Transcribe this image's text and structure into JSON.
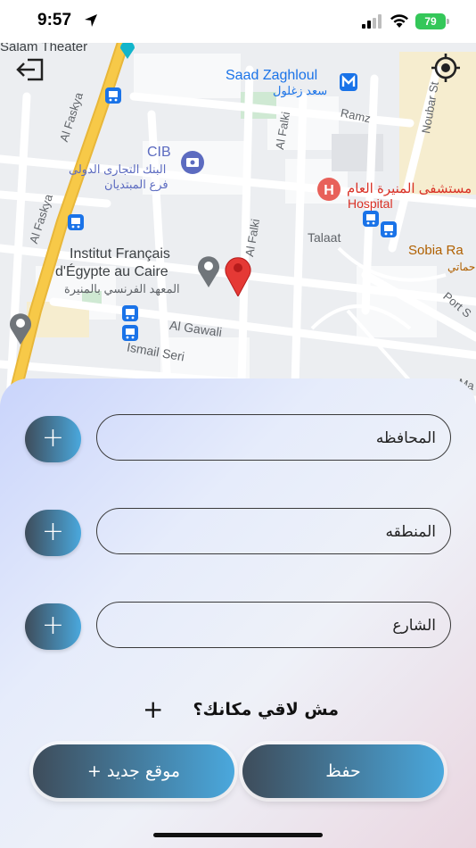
{
  "status_bar": {
    "time": "9:57",
    "battery": "79"
  },
  "map": {
    "labels": {
      "salam_theater": "Salam Theater",
      "saad_zaghloul": "Saad Zaghloul",
      "saad_zaghloul_ar": "سعد زغلول",
      "ramz": "Ramz",
      "noubar": "Noubar St",
      "al_faskya_1": "Al Faskya",
      "al_faskya_2": "Al Faskya",
      "al_falki_1": "Al Falki",
      "al_falki_2": "Al Falki",
      "cib": "CIB",
      "cib_ar_1": "البنك التجارى الدولى",
      "cib_ar_2": "فرع المبتديان",
      "hospital_ar": "مستشفى المنيرة العام",
      "hospital": "Hospital",
      "talaat": "Talaat",
      "sobia": "Sobia Ra",
      "sobia_ar": "حماتي",
      "institut_1": "Institut Français",
      "institut_2": "d'Égypte au Caire",
      "institut_ar": "المعهد الفرنسي بالمنيرة",
      "port": "Port S",
      "al_gawali": "Al Gawali",
      "ismail_seri": "Ismail Seri",
      "ma": "Ma"
    }
  },
  "form": {
    "fields": [
      {
        "placeholder": "المحافظه"
      },
      {
        "placeholder": "المنطقه"
      },
      {
        "placeholder": "الشارع"
      }
    ],
    "add_symbol": "+",
    "missing_location": "مش لاقي مكانك؟",
    "missing_symbol": "+",
    "new_location_button": "+ موقع جديد",
    "save_button": "حفظ"
  },
  "colors": {
    "accent_dark": "#3e4c5a",
    "accent_light": "#4aa8dd",
    "road_yellow": "#f7c948",
    "marker_red": "#e53935"
  }
}
